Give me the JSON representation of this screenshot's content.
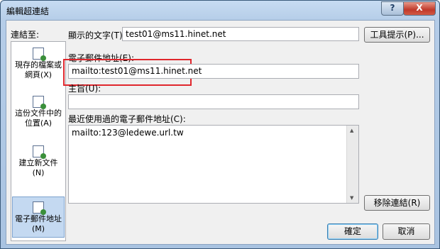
{
  "window": {
    "title": "編輯超連結",
    "help": "?",
    "close": "X"
  },
  "linkto": {
    "label": "連結至:"
  },
  "sidebar": {
    "items": [
      {
        "label_l1": "現存的檔案或",
        "label_l2": "網頁(X)",
        "icon": "existing-file-icon"
      },
      {
        "label_l1": "這份文件中的",
        "label_l2": "位置(A)",
        "icon": "document-place-icon"
      },
      {
        "label_l1": "建立新文件",
        "label_l2": "(N)",
        "icon": "new-document-icon"
      },
      {
        "label_l1": "電子郵件地址",
        "label_l2": "(M)",
        "icon": "email-icon",
        "selected": true
      }
    ]
  },
  "display_text": {
    "label": "顯示的文字(T):",
    "value": "test01@ms11.hinet.net"
  },
  "tooltip_button": {
    "label": "工具提示(P)..."
  },
  "email": {
    "label": "電子郵件地址(E):",
    "value": "mailto:test01@ms11.hinet.net"
  },
  "subject": {
    "label": "主旨(U):",
    "value": ""
  },
  "recent": {
    "label": "最近使用過的電子郵件地址(C):",
    "items": [
      "mailto:123@ledewe.url.tw"
    ]
  },
  "remove_button": {
    "label": "移除連結(R)"
  },
  "ok_button": {
    "label": "確定"
  },
  "cancel_button": {
    "label": "取消"
  }
}
